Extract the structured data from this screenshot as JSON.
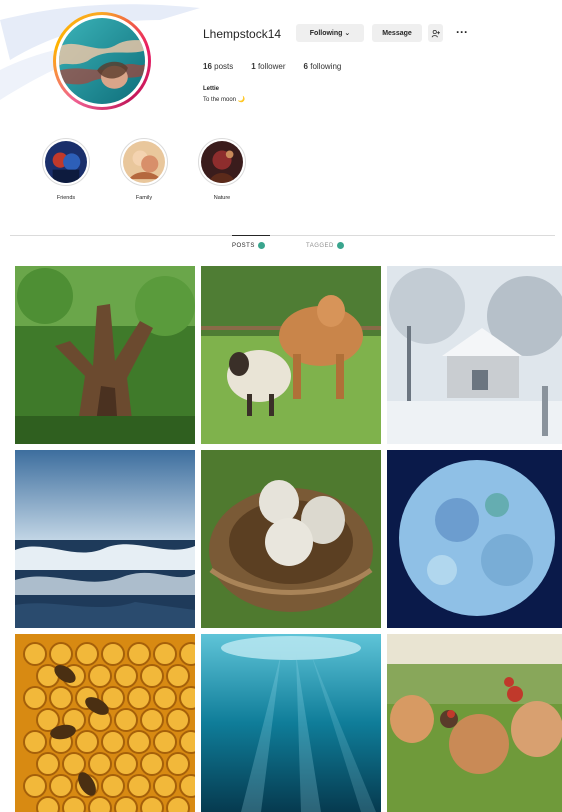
{
  "profile": {
    "username": "Lhempstock14",
    "following_button": "Following ⌄",
    "message_button": "Message",
    "more_label": "···",
    "stats": {
      "posts": "16",
      "posts_label": "posts",
      "followers": "1",
      "followers_label": "follower",
      "following": "6",
      "following_label": "following"
    },
    "full_name": "Lettie",
    "bio": "To the moon 🌙"
  },
  "highlights": [
    {
      "label": "Friends",
      "icon": "friends-highlight"
    },
    {
      "label": "Family",
      "icon": "family-highlight"
    },
    {
      "label": "Nature",
      "icon": "nature-highlight"
    }
  ],
  "tabs": {
    "posts": "POSTS",
    "tagged": "TAGGED"
  },
  "posts": [
    {
      "subject": "gnarled-tree-stump"
    },
    {
      "subject": "sheep-and-cow"
    },
    {
      "subject": "snowy-cottage"
    },
    {
      "subject": "stormy-sea"
    },
    {
      "subject": "eggs-in-nest"
    },
    {
      "subject": "full-moon"
    },
    {
      "subject": "bees-on-honeycomb"
    },
    {
      "subject": "underwater-light"
    },
    {
      "subject": "chickens-in-field"
    }
  ],
  "colors": {
    "accent_teal": "#3aa58e",
    "story_ring": "#e91e63",
    "button_bg": "#efefef"
  }
}
